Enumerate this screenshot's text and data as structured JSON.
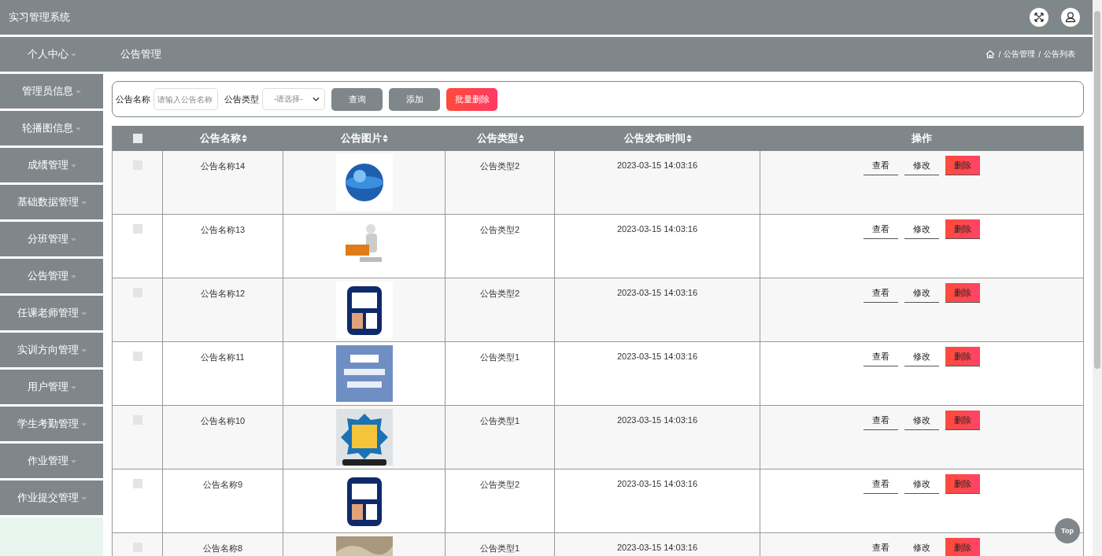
{
  "header": {
    "title": "实习管理系统"
  },
  "sidebar": {
    "items": [
      {
        "label": "个人中心"
      },
      {
        "label": "管理员信息"
      },
      {
        "label": "轮播图信息"
      },
      {
        "label": "成绩管理"
      },
      {
        "label": "基础数据管理"
      },
      {
        "label": "分班管理"
      },
      {
        "label": "公告管理"
      },
      {
        "label": "任课老师管理"
      },
      {
        "label": "实训方向管理"
      },
      {
        "label": "用户管理"
      },
      {
        "label": "学生考勤管理"
      },
      {
        "label": "作业管理"
      },
      {
        "label": "作业提交管理"
      }
    ]
  },
  "page_title": "公告管理",
  "breadcrumb": [
    {
      "sep": "/",
      "label": "公告管理"
    },
    {
      "sep": "/",
      "label": "公告列表"
    }
  ],
  "search": {
    "name_label": "公告名称",
    "name_placeholder": "请输入公告名称",
    "type_label": "公告类型",
    "type_placeholder": "-请选择-",
    "buttons": [
      {
        "label": "查询",
        "kind": "plain"
      },
      {
        "label": "添加",
        "kind": "plain"
      },
      {
        "label": "批量删除",
        "kind": "danger"
      }
    ]
  },
  "table": {
    "header_checked": false,
    "columns": [
      "公告名称",
      "公告图片",
      "公告类型",
      "公告发布时间",
      "操作"
    ],
    "rows": [
      {
        "checked": false,
        "name": "公告名称14",
        "type": "公告类型2",
        "time": "2023-03-15 14:03:16",
        "actions": [
          "查看",
          "修改",
          "删除"
        ]
      },
      {
        "checked": false,
        "name": "公告名称13",
        "type": "公告类型2",
        "time": "2023-03-15 14:03:16",
        "actions": [
          "查看",
          "修改",
          "删除"
        ]
      },
      {
        "checked": false,
        "name": "公告名称12",
        "type": "公告类型2",
        "time": "2023-03-15 14:03:16",
        "actions": [
          "查看",
          "修改",
          "删除"
        ]
      },
      {
        "checked": false,
        "name": "公告名称11",
        "type": "公告类型1",
        "time": "2023-03-15 14:03:16",
        "actions": [
          "查看",
          "修改",
          "删除"
        ]
      },
      {
        "checked": false,
        "name": "公告名称10",
        "type": "公告类型1",
        "time": "2023-03-15 14:03:16",
        "actions": [
          "查看",
          "修改",
          "删除"
        ]
      },
      {
        "checked": false,
        "name": "公告名称9",
        "type": "公告类型2",
        "time": "2023-03-15 14:03:16",
        "actions": [
          "查看",
          "修改",
          "删除"
        ]
      },
      {
        "checked": false,
        "name": "公告名称8",
        "type": "公告类型1",
        "time": "2023-03-15 14:03:16",
        "actions": [
          "查看",
          "修改",
          "删除"
        ]
      }
    ]
  },
  "top_button": "Top"
}
